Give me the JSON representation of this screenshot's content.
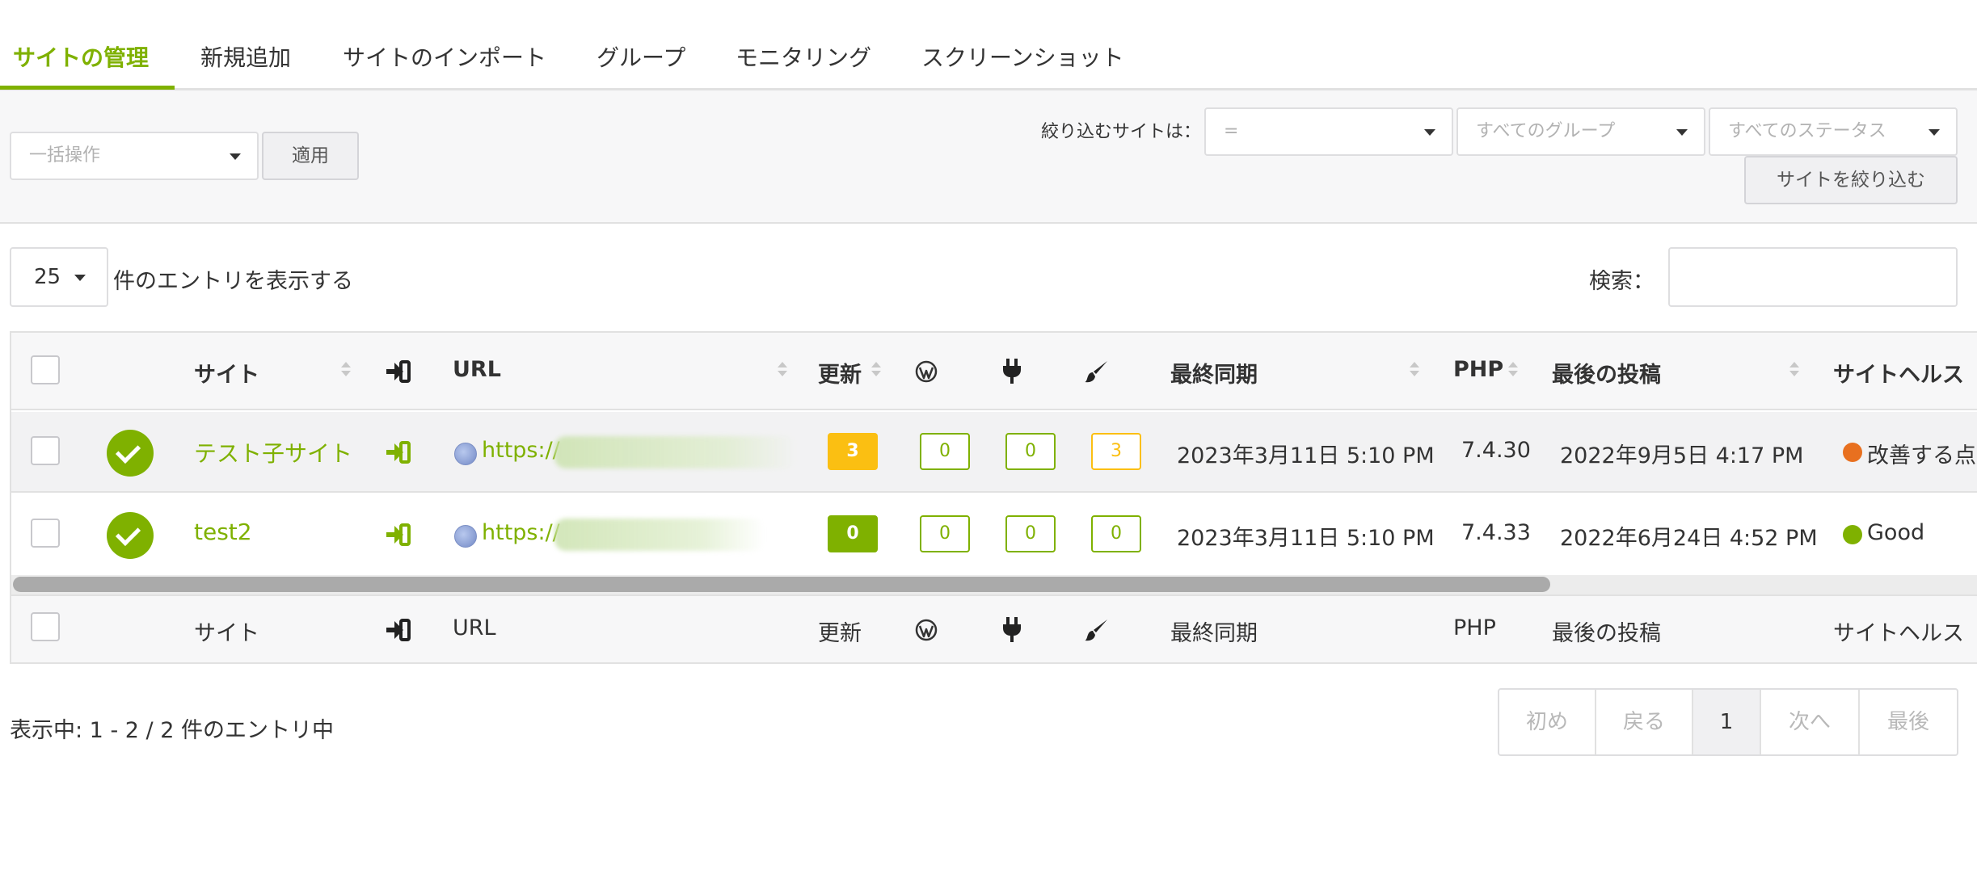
{
  "tabs": [
    {
      "label": "サイトの管理",
      "active": true
    },
    {
      "label": "新規追加"
    },
    {
      "label": "サイトのインポート"
    },
    {
      "label": "グループ"
    },
    {
      "label": "モニタリング"
    },
    {
      "label": "スクリーンショット"
    }
  ],
  "toolbar": {
    "bulk_placeholder": "一括操作",
    "apply_label": "適用",
    "filter_label": "絞り込むサイトは：",
    "filter_site_value": "=",
    "filter_group_placeholder": "すべてのグループ",
    "filter_status_placeholder": "すべてのステータス",
    "filter_button_label": "サイトを絞り込む"
  },
  "table_controls": {
    "page_length": "25",
    "length_label": "件のエントリを表示する",
    "search_label": "検索："
  },
  "columns": {
    "site": "サイト",
    "url": "URL",
    "updates": "更新",
    "last_sync": "最終同期",
    "php": "PHP",
    "last_post": "最後の投稿",
    "site_health": "サイトヘルス"
  },
  "icons": {
    "login": "sign-in-icon",
    "wordpress": "wordpress-icon",
    "plugins": "plug-icon",
    "themes": "paintbrush-icon",
    "status": "check-circle-icon",
    "globe": "globe-icon"
  },
  "rows": [
    {
      "site": "テスト子サイト",
      "url": "https://",
      "updates": "3",
      "wp": "0",
      "plugins": "0",
      "themes": "3",
      "last_sync": "2023年3月11日 5:10 PM",
      "php": "7.4.30",
      "last_post": "2022年9月5日 4:17 PM",
      "health": "改善する点",
      "health_color": "#e8701f"
    },
    {
      "site": "test2",
      "url": "https://",
      "updates": "0",
      "wp": "0",
      "plugins": "0",
      "themes": "0",
      "last_sync": "2023年3月11日 5:10 PM",
      "php": "7.4.33",
      "last_post": "2022年6月24日 4:52 PM",
      "health": "Good",
      "health_color": "#7fb100"
    }
  ],
  "pagination": {
    "info": "表示中: 1 - 2 / 2 件のエントリ中",
    "first": "初め",
    "prev": "戻る",
    "current": "1",
    "next": "次へ",
    "last": "最後"
  },
  "colors": {
    "accent": "#7fb100",
    "warning": "#fbbf12",
    "health_warn": "#e8701f"
  }
}
